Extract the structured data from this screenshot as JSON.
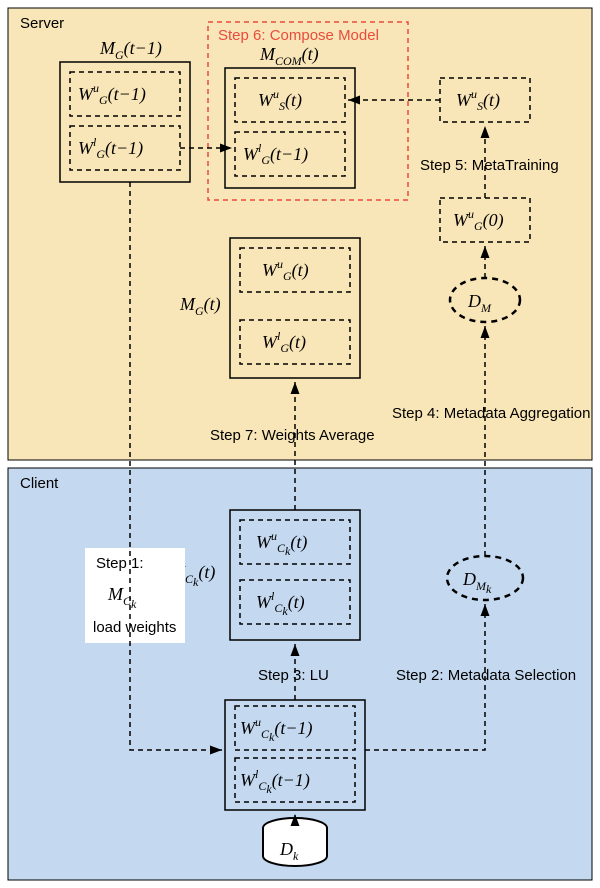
{
  "regions": {
    "server": "Server",
    "client": "Client"
  },
  "steps": {
    "s1a": "Step 1:",
    "s1b": "load weights",
    "s2": "Step 2: Metadata Selection",
    "s3": "Step 3: LU",
    "s4": "Step 4: Metadata Aggregation",
    "s5": "Step 5: MetaTraining",
    "s6": "Step 6: Compose Model",
    "s7": "Step 7: Weights Average"
  },
  "models": {
    "mg_t1": "M_G(t−1)",
    "mcom": "M_COM(t)",
    "mg_t": "M_G(t)",
    "mck": "M_{C_k}(t)",
    "mck_plain": "M_{C_k}"
  },
  "weights": {
    "wgu_t1": "W_G^u(t−1)",
    "wgl_t1": "W_G^l(t−1)",
    "wsu_t": "W_S^u(t)",
    "wgu_0": "W_G^u(0)",
    "wgu_t": "W_G^u(t)",
    "wgl_t": "W_G^l(t)",
    "wcku_t": "W_{C_k}^u(t)",
    "wckl_t": "W_{C_k}^l(t)",
    "wcku_t1": "W_{C_k}^u(t−1)",
    "wckl_t1": "W_{C_k}^l(t−1)"
  },
  "data": {
    "dm": "D_M",
    "dmk": "D_{M_k}",
    "dk": "D_k"
  },
  "colors": {
    "server": "#f9e6b8",
    "client": "#c4d9f0",
    "red": "#e74c3c"
  }
}
